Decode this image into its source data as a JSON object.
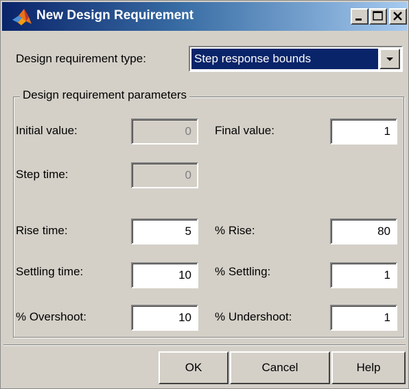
{
  "window": {
    "title": "New Design Requirement",
    "icon": "matlab-icon",
    "controls": [
      "minimize-icon",
      "maximize-icon",
      "close-icon"
    ]
  },
  "type_row": {
    "label": "Design requirement type:",
    "selected": "Step response bounds"
  },
  "parameters": {
    "group_title": "Design requirement parameters",
    "initial_value": {
      "label": "Initial value:",
      "value": "0",
      "enabled": false
    },
    "final_value": {
      "label": "Final value:",
      "value": "1",
      "enabled": true
    },
    "step_time": {
      "label": "Step time:",
      "value": "0",
      "enabled": false
    },
    "rise_time": {
      "label": "Rise time:",
      "value": "5"
    },
    "pct_rise": {
      "label": "% Rise:",
      "value": "80"
    },
    "settling_time": {
      "label": "Settling time:",
      "value": "10"
    },
    "pct_settling": {
      "label": "% Settling:",
      "value": "1"
    },
    "pct_overshoot": {
      "label": "% Overshoot:",
      "value": "10"
    },
    "pct_undershoot": {
      "label": "% Undershoot:",
      "value": "1"
    }
  },
  "buttons": {
    "ok": "OK",
    "cancel": "Cancel",
    "help": "Help"
  },
  "colors": {
    "dialog_bg": "#d4d0c8",
    "title_start": "#0a246a",
    "title_end": "#a6caf0",
    "selection": "#0a246a"
  }
}
